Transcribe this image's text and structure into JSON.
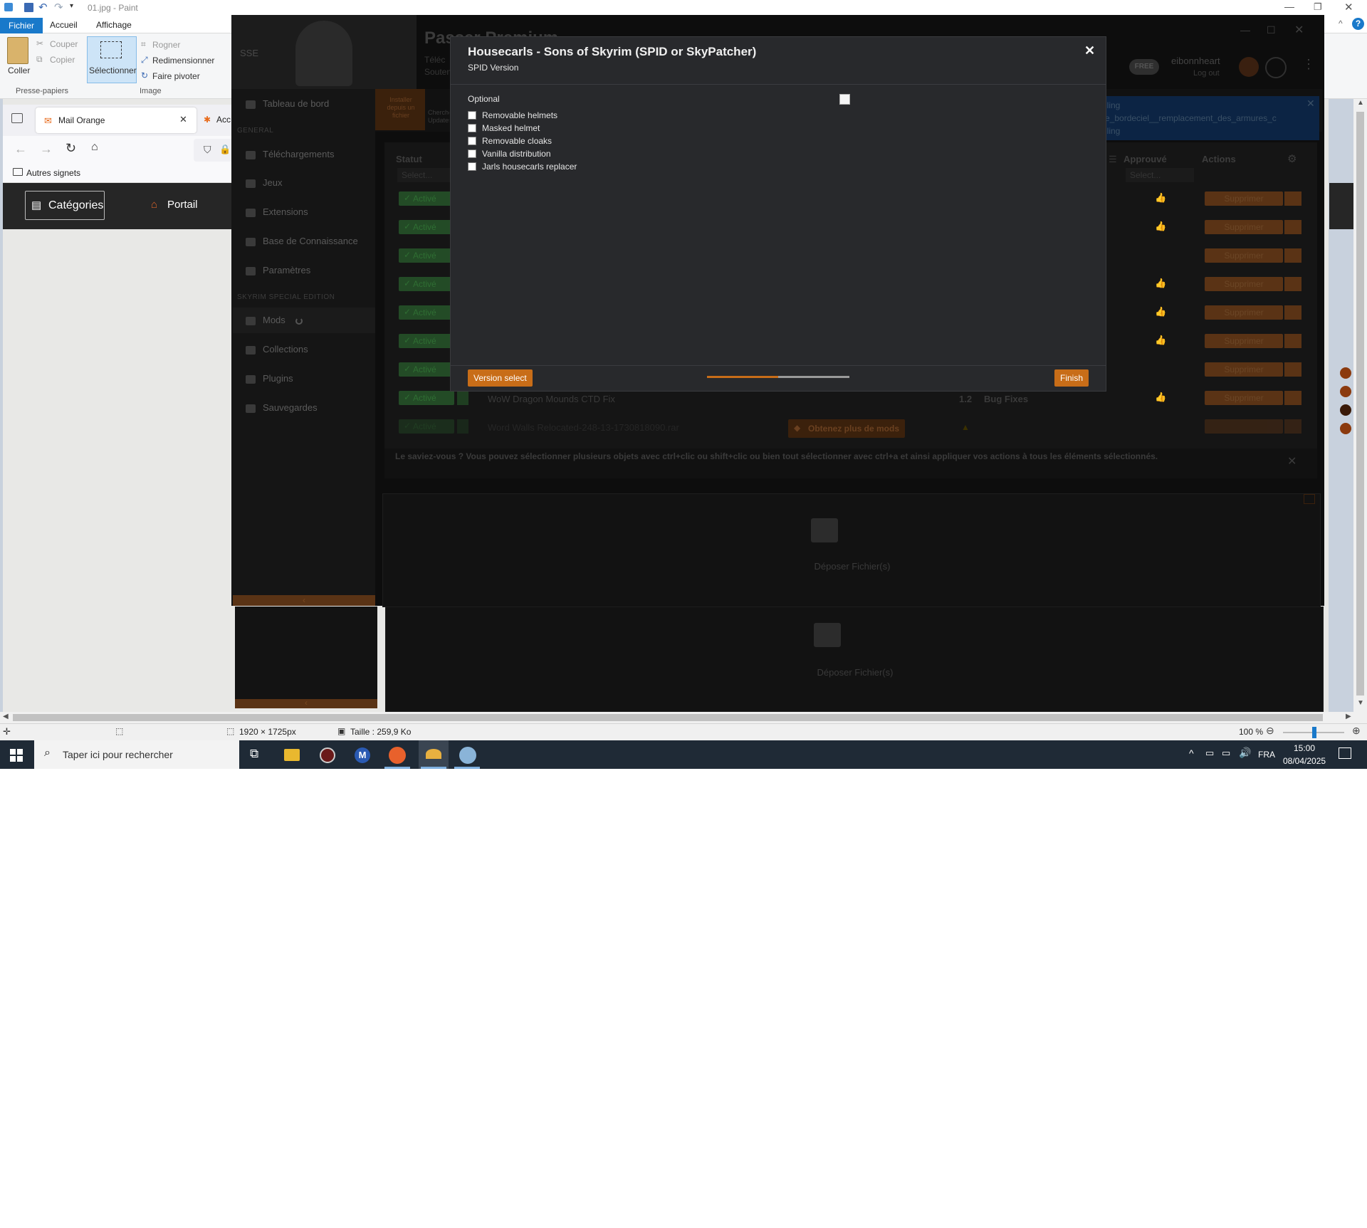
{
  "paint": {
    "window_title": "01.jpg - Paint",
    "tabs": [
      "Fichier",
      "Accueil",
      "Affichage"
    ],
    "clipboard": {
      "paste": "Coller",
      "cut": "Couper",
      "copy": "Copier",
      "group": "Presse-papiers"
    },
    "image": {
      "select": "Sélectionner",
      "crop": "Rogner",
      "resize": "Redimensionner",
      "rotate": "Faire pivoter",
      "group": "Image"
    },
    "status": {
      "dimensions": "1920 × 1725px",
      "size": "Taille : 259,9 Ko",
      "zoom": "100 %"
    }
  },
  "browser": {
    "tabs": [
      "Mail Orange",
      "Acc"
    ],
    "bookmarks": "Autres signets",
    "nav": {
      "categories": "Catégories",
      "portal": "Portail"
    }
  },
  "vortex": {
    "game": "SSE",
    "premium_title": "Passer Premium",
    "premium_sub1": "Téléc",
    "premium_sub2": "Souten",
    "free_badge": "FREE",
    "user": "eibonnheart",
    "logout": "Log out",
    "nav": {
      "dashboard": "Tableau de bord",
      "general_header": "GENERAL",
      "downloads": "Téléchargements",
      "games": "Jeux",
      "extensions": "Extensions",
      "knowledge": "Base de Connaissance",
      "settings": "Paramètres",
      "game_header": "SKYRIM SPECIAL EDITION",
      "mods": "Mods",
      "collections": "Collections",
      "plugins": "Plugins",
      "saves": "Sauvegardes"
    },
    "toolbar": {
      "install_from_file": "Installer depuis un fichier",
      "check_updates": "Chercher Updates"
    },
    "notice": {
      "line1": "lling",
      "line2": "e_bordeciel__remplacement_des_armures_c",
      "line3": "lling"
    },
    "table": {
      "col_status": "Statut",
      "col_approved": "Approuvé",
      "col_actions": "Actions",
      "filter_placeholder": "Select...",
      "status_value": "Activé",
      "action_label": "Supprimer",
      "visible_row_name": "WoW Dragon Mounds CTD Fix",
      "visible_row_version": "1.2",
      "visible_row_category": "Bug Fixes",
      "faded_row_name": "Word Walls Relocated-248-13-1730818090.rar",
      "get_more": "Obtenez plus de mods"
    },
    "tip": "Le saviez-vous ? Vous pouvez sélectionner plusieurs objets avec ctrl+clic ou shift+clic ou bien tout sélectionner avec ctrl+a et ainsi appliquer vos actions à tous les éléments sélectionnés.",
    "drop_files": "Déposer Fichier(s)"
  },
  "modal": {
    "title": "Housecarls - Sons of Skyrim (SPID or SkyPatcher)",
    "subtitle": "SPID Version",
    "group_label": "Optional",
    "options": [
      {
        "label": "Removable helmets",
        "checked": false
      },
      {
        "label": "Masked helmet",
        "checked": false
      },
      {
        "label": "Removable cloaks",
        "checked": false
      },
      {
        "label": "Vanilla distribution",
        "checked": false
      },
      {
        "label": "Jarls housecarls replacer",
        "checked": false
      }
    ],
    "back_button": "Version select",
    "finish_button": "Finish",
    "progress": 0.5,
    "close_glyph": "✕"
  },
  "taskbar": {
    "search_placeholder": "Taper ici pour rechercher",
    "lang": "FRA",
    "time": "15:00",
    "date": "08/04/2025"
  },
  "colors": {
    "accent": "#c86d18",
    "modal_bg": "#28292c",
    "vortex_bg": "#0d0d0d",
    "taskbar": "#1f2a36",
    "paint_blue": "#1979ca"
  }
}
